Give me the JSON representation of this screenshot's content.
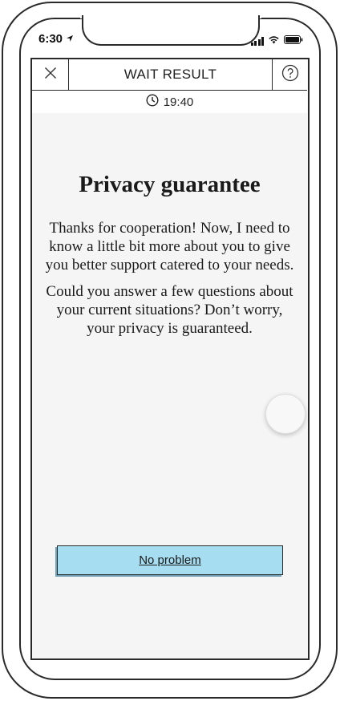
{
  "status_bar": {
    "time": "6:30",
    "location_icon": "location-arrow-icon",
    "signal_icon": "signal-bars-icon",
    "wifi_icon": "wifi-icon",
    "battery_icon": "battery-icon"
  },
  "header": {
    "title": "WAIT RESULT",
    "close_icon": "close-icon",
    "help_icon": "question-circle-icon"
  },
  "timer": {
    "icon": "clock-icon",
    "value": "19:40"
  },
  "main": {
    "heading": "Privacy guarantee",
    "paragraph_1": "Thanks for cooperation! Now, I need to know a little bit more about you to give you better support catered to your needs.",
    "paragraph_2": "Could you answer a few questions about your current situations? Don’t worry, your privacy is guaranteed."
  },
  "cta": {
    "label": "No problem",
    "color": "#a6ddf1"
  }
}
